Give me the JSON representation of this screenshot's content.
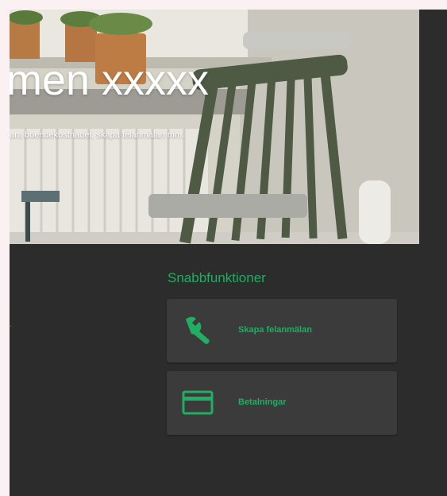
{
  "hero": {
    "title": "men xxxxx",
    "subtitle": "ara boendekostnader, skapa felanmälan mm."
  },
  "quick_functions": {
    "title": "Snabbfunktioner",
    "items": [
      {
        "label": "Skapa felanmälan",
        "icon": "wrench-icon"
      },
      {
        "label": "Betalningar",
        "icon": "credit-card-icon"
      }
    ]
  },
  "colors": {
    "accent": "#1fae62",
    "panel": "#2c2c2c",
    "card": "#3b3b3b",
    "page_background": "#fbf1f3"
  }
}
